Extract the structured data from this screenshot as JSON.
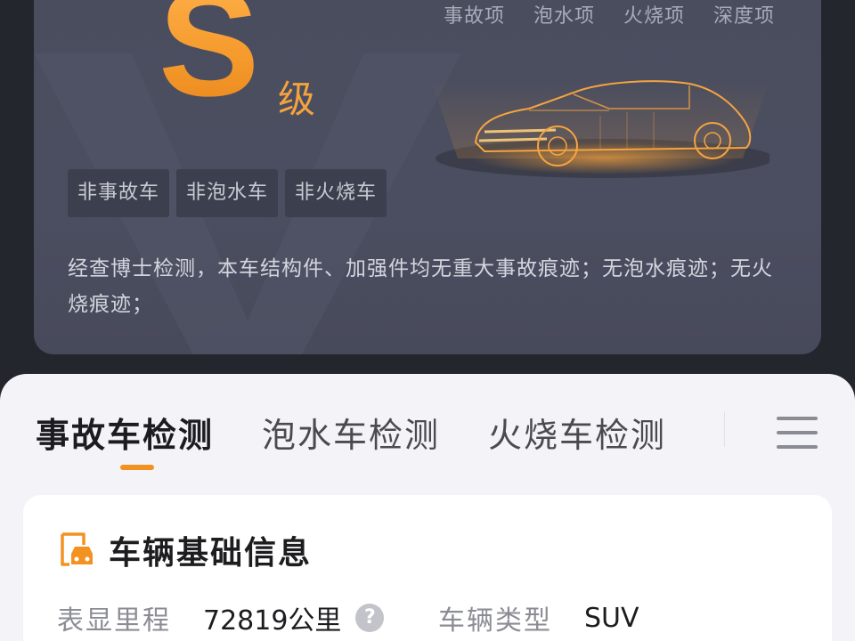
{
  "report": {
    "grade_letter": "S",
    "grade_suffix": "级",
    "check_items": [
      "事故项",
      "泡水项",
      "火烧项",
      "深度项"
    ],
    "tags": [
      "非事故车",
      "非泡水车",
      "非火烧车"
    ],
    "summary": "经查博士检测，本车结构件、加强件均无重大事故痕迹；无泡水痕迹；无火烧痕迹；",
    "colors": {
      "accent": "#f39220",
      "card_bg": "#4a4d5e"
    }
  },
  "tabs": [
    {
      "label": "事故车检测",
      "active": true
    },
    {
      "label": "泡水车检测",
      "active": false
    },
    {
      "label": "火烧车检测",
      "active": false
    }
  ],
  "menu_icon": "hamburger-icon",
  "vehicle_info": {
    "icon": "car-document-icon",
    "title": "车辆基础信息",
    "mileage_label": "表显里程",
    "mileage_value": "72819公里",
    "help_icon": "question-icon",
    "type_label": "车辆类型",
    "type_value": "SUV"
  }
}
